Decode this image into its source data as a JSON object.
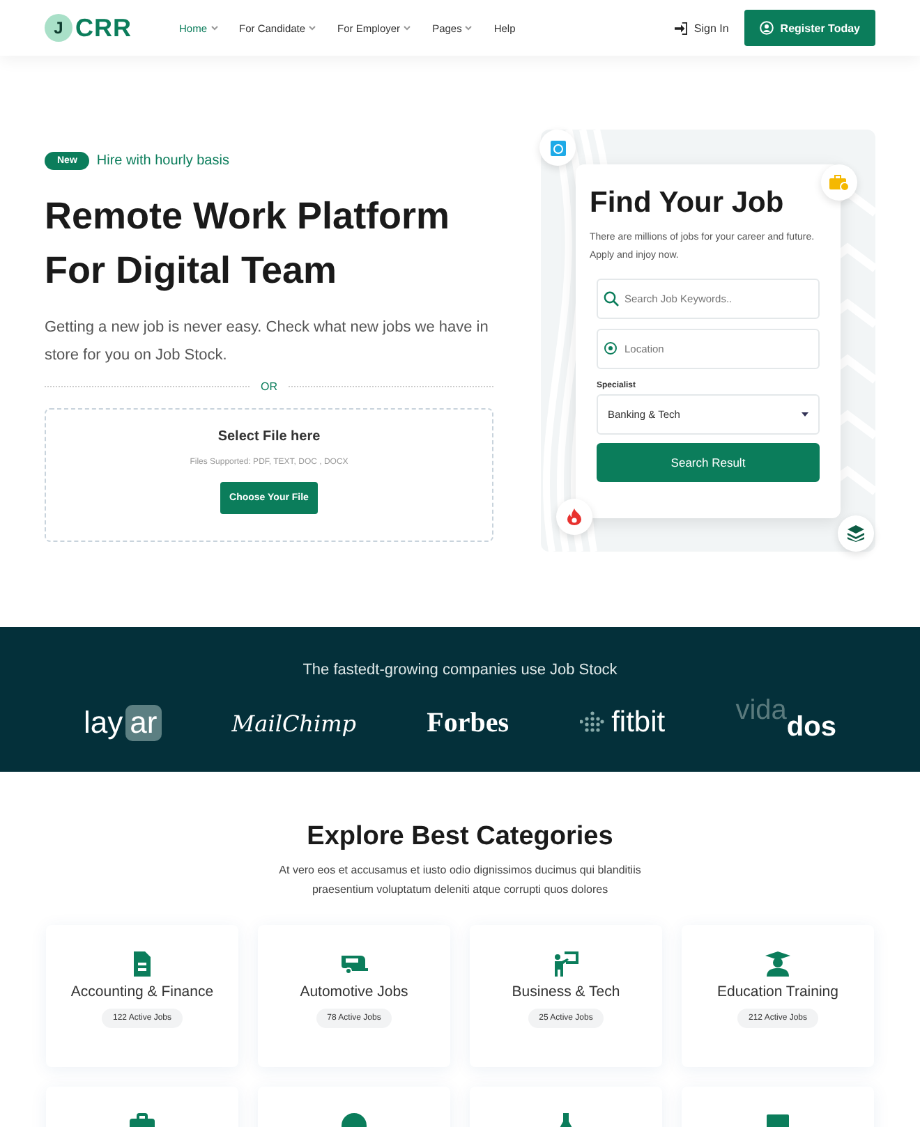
{
  "header": {
    "logo": {
      "mark": "J",
      "text": "CRR"
    },
    "nav": [
      {
        "label": "Home",
        "selected": true,
        "dropdown": true
      },
      {
        "label": "For Candidate",
        "selected": false,
        "dropdown": true
      },
      {
        "label": "For Employer",
        "selected": false,
        "dropdown": true
      },
      {
        "label": "Pages",
        "selected": false,
        "dropdown": true
      },
      {
        "label": "Help",
        "selected": false,
        "dropdown": false
      }
    ],
    "sign_in": "Sign In",
    "register": "Register Today"
  },
  "hero": {
    "badge": "New",
    "tagline": "Hire with hourly basis",
    "title": "Remote Work Platform For Digital Team",
    "description": "Getting a new job is never easy. Check what new jobs we have in store for you on Job Stock.",
    "divider": "OR",
    "upload": {
      "title": "Select File here",
      "hint": "Files Supported: PDF, TEXT, DOC , DOCX",
      "button": "Choose Your File"
    }
  },
  "search_card": {
    "title": "Find Your Job",
    "description": "There are millions of jobs for your career and future. Apply and injoy now.",
    "keyword": {
      "placeholder": "Search Job Keywords.."
    },
    "location": {
      "placeholder": "Location"
    },
    "specialist": {
      "label": "Specialist",
      "value": "Banking & Tech"
    },
    "button": "Search Result"
  },
  "companies": {
    "title": "The fastedt-growing companies use Job Stock",
    "logos": [
      {
        "kind": "layar",
        "parts": [
          "lay",
          "ar"
        ]
      },
      {
        "kind": "mailchimp",
        "parts": [
          "MailChimp"
        ]
      },
      {
        "kind": "forbes",
        "parts": [
          "Forbes"
        ]
      },
      {
        "kind": "fitbit",
        "parts": [
          "fitbit"
        ]
      },
      {
        "kind": "vidados",
        "parts": [
          "vida",
          "dos"
        ]
      }
    ]
  },
  "categories": {
    "title": "Explore Best Categories",
    "description": "At vero eos et accusamus et iusto odio dignissimos ducimus qui blanditiis praesentium voluptatum deleniti atque corrupti quos dolores",
    "items": [
      {
        "name": "Accounting & Finance",
        "count": "122 Active Jobs",
        "kind": "document"
      },
      {
        "name": "Automotive Jobs",
        "count": "78 Active Jobs",
        "kind": "trailer"
      },
      {
        "name": "Business & Tech",
        "count": "25 Active Jobs",
        "kind": "presenter"
      },
      {
        "name": "Education Training",
        "count": "212 Active Jobs",
        "kind": "graduate"
      },
      {
        "kind": "briefcase"
      },
      {
        "kind": "globe"
      },
      {
        "kind": "flask"
      },
      {
        "kind": "monitor"
      }
    ]
  }
}
